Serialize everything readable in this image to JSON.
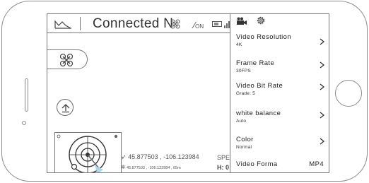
{
  "topbar": {
    "status": "Connected N",
    "off_label": "ON"
  },
  "telemetry": {
    "coords": "45.877503 , -106.123984",
    "coords_sub": "45.877503 , -106.123984 , 65m",
    "speed_label": "SPE",
    "height_label": "H: 0"
  },
  "camera_settings": {
    "items": [
      {
        "title": "Video Resolution",
        "value": "4K"
      },
      {
        "title": "Frame Rate",
        "value": "30FPS"
      },
      {
        "title": "Video Bit Rate",
        "value": "Grade: 5"
      },
      {
        "title": "white balance",
        "value": "Auto"
      },
      {
        "title": "Color",
        "value": "Normal"
      }
    ],
    "format": {
      "title": "Video Forma",
      "value": "MP4"
    }
  },
  "icons": [
    "home-icon",
    "fan-icon",
    "obstacle-off-icon",
    "battery-icon",
    "signal-icon",
    "camera-icon",
    "gear-icon",
    "takeoff-icon",
    "chevron-right-icon"
  ]
}
